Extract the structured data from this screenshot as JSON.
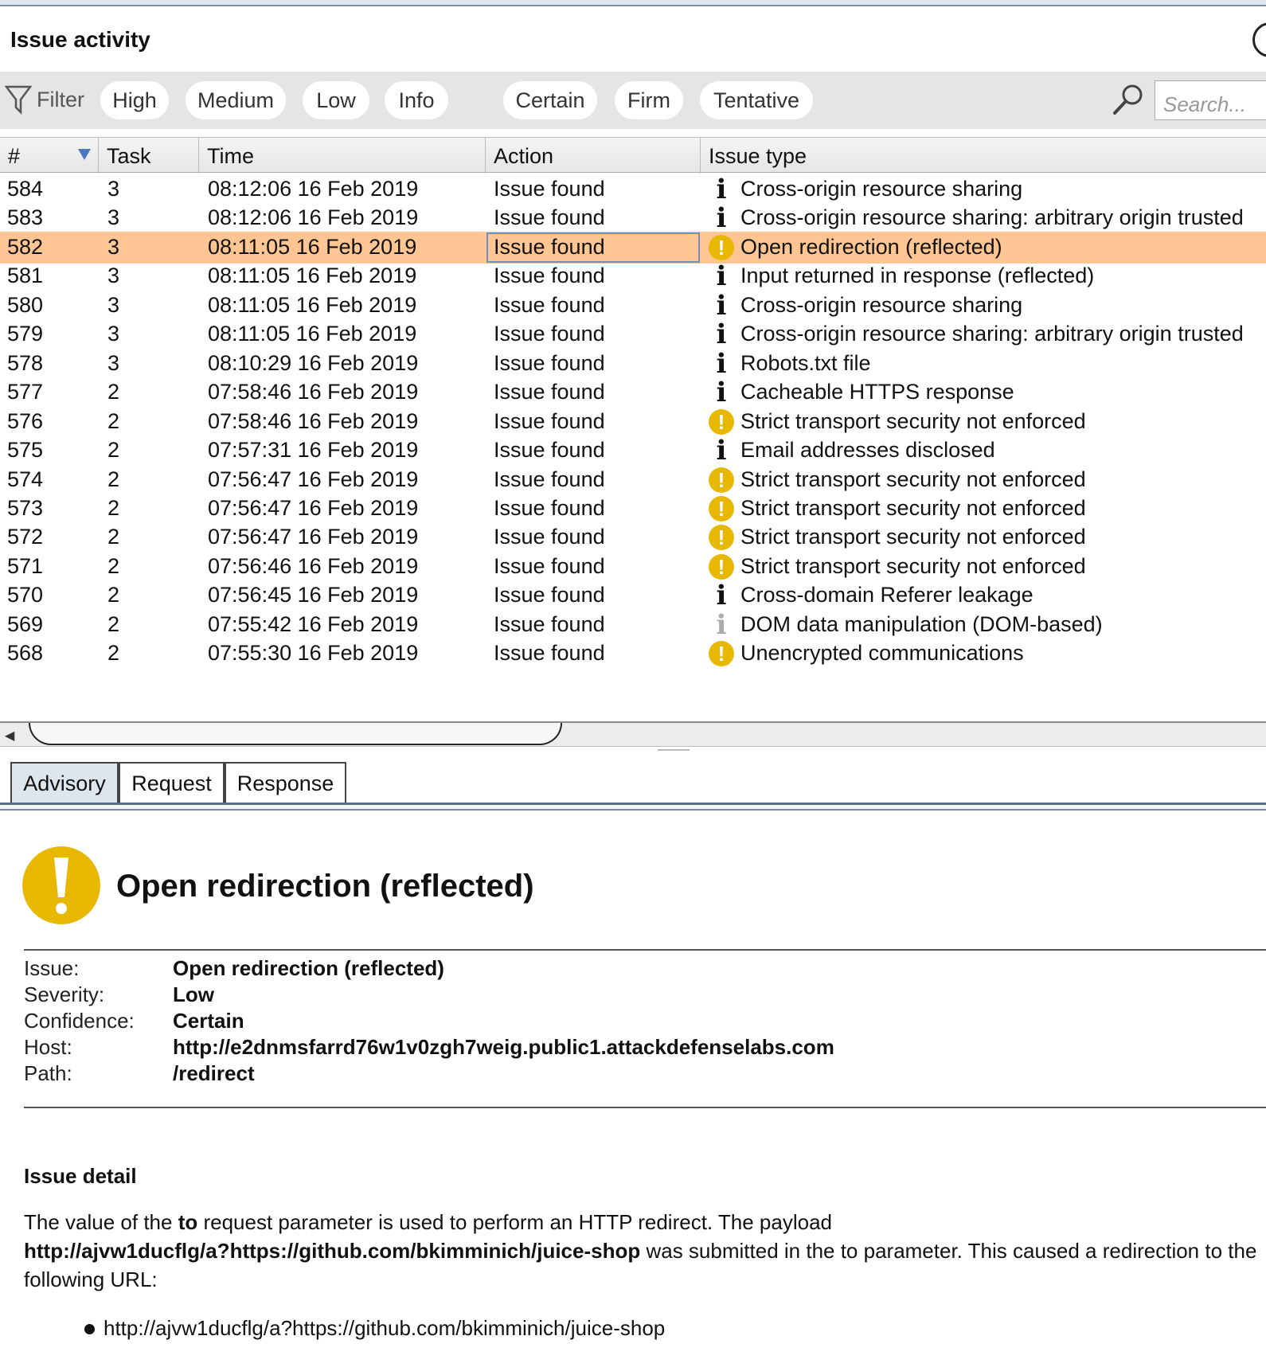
{
  "panel": {
    "title": "Issue activity"
  },
  "filter": {
    "label": "Filter",
    "severity": [
      "High",
      "Medium",
      "Low",
      "Info"
    ],
    "confidence": [
      "Certain",
      "Firm",
      "Tentative"
    ],
    "search_placeholder": "Search..."
  },
  "table": {
    "columns": [
      "#",
      "Task",
      "Time",
      "Action",
      "Issue type"
    ],
    "rows": [
      {
        "num": "584",
        "task": "3",
        "time": "08:12:06 16 Feb 2019",
        "action": "Issue found",
        "icon": "info-icon",
        "type": "Cross-origin resource sharing"
      },
      {
        "num": "583",
        "task": "3",
        "time": "08:12:06 16 Feb 2019",
        "action": "Issue found",
        "icon": "info-icon",
        "type": "Cross-origin resource sharing: arbitrary origin trusted"
      },
      {
        "num": "582",
        "task": "3",
        "time": "08:11:05 16 Feb 2019",
        "action": "Issue found",
        "icon": "warning-icon",
        "type": "Open redirection (reflected)",
        "selected": true
      },
      {
        "num": "581",
        "task": "3",
        "time": "08:11:05 16 Feb 2019",
        "action": "Issue found",
        "icon": "info-icon",
        "type": "Input returned in response (reflected)"
      },
      {
        "num": "580",
        "task": "3",
        "time": "08:11:05 16 Feb 2019",
        "action": "Issue found",
        "icon": "info-icon",
        "type": "Cross-origin resource sharing"
      },
      {
        "num": "579",
        "task": "3",
        "time": "08:11:05 16 Feb 2019",
        "action": "Issue found",
        "icon": "info-icon",
        "type": "Cross-origin resource sharing: arbitrary origin trusted"
      },
      {
        "num": "578",
        "task": "3",
        "time": "08:10:29 16 Feb 2019",
        "action": "Issue found",
        "icon": "info-icon",
        "type": "Robots.txt file"
      },
      {
        "num": "577",
        "task": "2",
        "time": "07:58:46 16 Feb 2019",
        "action": "Issue found",
        "icon": "info-icon",
        "type": "Cacheable HTTPS response"
      },
      {
        "num": "576",
        "task": "2",
        "time": "07:58:46 16 Feb 2019",
        "action": "Issue found",
        "icon": "warning-icon",
        "type": "Strict transport security not enforced"
      },
      {
        "num": "575",
        "task": "2",
        "time": "07:57:31 16 Feb 2019",
        "action": "Issue found",
        "icon": "info-icon",
        "type": "Email addresses disclosed"
      },
      {
        "num": "574",
        "task": "2",
        "time": "07:56:47 16 Feb 2019",
        "action": "Issue found",
        "icon": "warning-icon",
        "type": "Strict transport security not enforced"
      },
      {
        "num": "573",
        "task": "2",
        "time": "07:56:47 16 Feb 2019",
        "action": "Issue found",
        "icon": "warning-icon",
        "type": "Strict transport security not enforced"
      },
      {
        "num": "572",
        "task": "2",
        "time": "07:56:47 16 Feb 2019",
        "action": "Issue found",
        "icon": "warning-icon",
        "type": "Strict transport security not enforced"
      },
      {
        "num": "571",
        "task": "2",
        "time": "07:56:46 16 Feb 2019",
        "action": "Issue found",
        "icon": "warning-icon",
        "type": "Strict transport security not enforced"
      },
      {
        "num": "570",
        "task": "2",
        "time": "07:56:45 16 Feb 2019",
        "action": "Issue found",
        "icon": "info-icon",
        "type": "Cross-domain Referer leakage"
      },
      {
        "num": "569",
        "task": "2",
        "time": "07:55:42 16 Feb 2019",
        "action": "Issue found",
        "icon": "info-icon-faded",
        "type": "DOM data manipulation (DOM-based)"
      },
      {
        "num": "568",
        "task": "2",
        "time": "07:55:30 16 Feb 2019",
        "action": "Issue found",
        "icon": "warning-icon",
        "type": "Unencrypted communications"
      }
    ]
  },
  "tabs": [
    "Advisory",
    "Request",
    "Response"
  ],
  "advisory": {
    "title": "Open redirection (reflected)",
    "meta": [
      {
        "label": "Issue:",
        "value": "Open redirection (reflected)"
      },
      {
        "label": "Severity:",
        "value": "Low"
      },
      {
        "label": "Confidence:",
        "value": "Certain"
      },
      {
        "label": "Host:",
        "value": "http://e2dnmsfarrd76w1v0zgh7weig.public1.attackdefenselabs.com"
      },
      {
        "label": "Path:",
        "value": "/redirect"
      }
    ],
    "detail_heading": "Issue detail",
    "detail_p1": "The value of the ",
    "detail_param": "to",
    "detail_p2": " request parameter is used to perform an HTTP redirect. The payload",
    "detail_payload": "http://ajvw1ducflg/a?https://github.com/bkimminich/juice-shop",
    "detail_p3": " was submitted in the to parameter. This caused a redirection to the following URL:",
    "redirect_url": "http://ajvw1ducflg/a?https://github.com/bkimminich/juice-shop"
  },
  "colors": {
    "selected_row": "#ffc592",
    "warning": "#e8b800"
  }
}
